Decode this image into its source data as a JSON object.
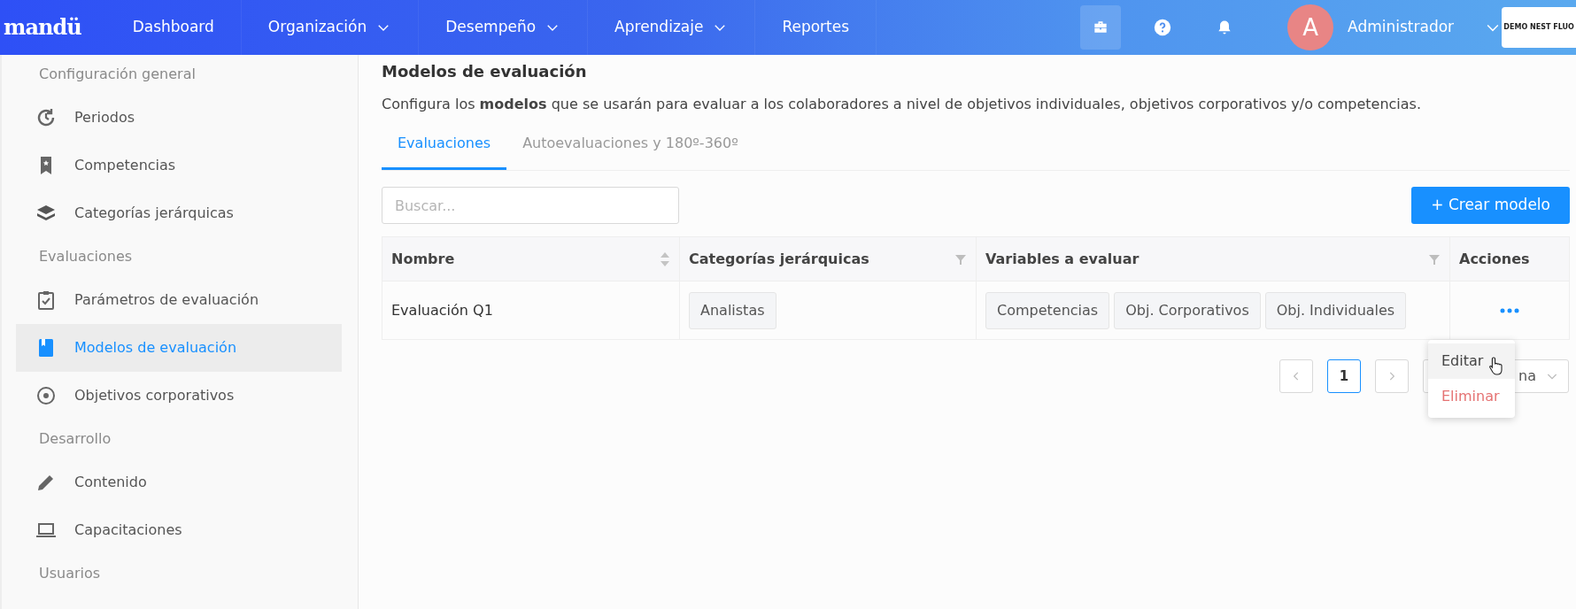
{
  "navbar": {
    "logo": "mandü",
    "items": [
      {
        "label": "Dashboard",
        "dropdown": false
      },
      {
        "label": "Organización",
        "dropdown": true
      },
      {
        "label": "Desempeño",
        "dropdown": true
      },
      {
        "label": "Aprendizaje",
        "dropdown": true
      },
      {
        "label": "Reportes",
        "dropdown": false
      }
    ],
    "user": {
      "avatar_letter": "A",
      "name": "Administrador"
    },
    "company": "DEMO NEST FLUO"
  },
  "sidebar": [
    {
      "heading": "Configuración general",
      "items": [
        {
          "label": "Periodos",
          "selected": false
        },
        {
          "label": "Competencias",
          "selected": false
        },
        {
          "label": "Categorías jerárquicas",
          "selected": false
        }
      ]
    },
    {
      "heading": "Evaluaciones",
      "items": [
        {
          "label": "Parámetros de evaluación",
          "selected": false
        },
        {
          "label": "Modelos de evaluación",
          "selected": true
        },
        {
          "label": "Objetivos corporativos",
          "selected": false
        }
      ]
    },
    {
      "heading": "Desarrollo",
      "items": [
        {
          "label": "Contenido",
          "selected": false
        },
        {
          "label": "Capacitaciones",
          "selected": false
        }
      ]
    },
    {
      "heading": "Usuarios"
    }
  ],
  "page": {
    "title": "Modelos de evaluación",
    "description": "Configura los **modelos** que se usarán para evaluar a los colaboradores a nivel de objetivos individuales, objetivos corporativos y/o competencias."
  },
  "tabs": [
    {
      "label": "Evaluaciones",
      "selected": true
    },
    {
      "label": "Autoevaluaciones y 180º-360º",
      "selected": false
    }
  ],
  "search": {
    "placeholder": "Buscar..."
  },
  "create_button": "+ Crear modelo",
  "table": {
    "columns": [
      {
        "label": "Nombre",
        "kind": "sortable"
      },
      {
        "label": "Categorías jerárquicas",
        "kind": "filterable"
      },
      {
        "label": "Variables a evaluar",
        "kind": "filterable"
      },
      {
        "label": "Acciones",
        "kind": "plain"
      }
    ],
    "rows": [
      {
        "name": "Evaluación Q1",
        "categories": [
          "Analistas"
        ],
        "variables": [
          "Competencias",
          "Obj. Corporativos",
          "Obj. Individuales"
        ]
      }
    ]
  },
  "pagination": {
    "pages": [
      {
        "label": "1",
        "selected": true
      }
    ],
    "page_size": "na"
  },
  "action_menu": [
    {
      "label": "Editar",
      "kind": "normal",
      "hovered": true
    },
    {
      "label": "Eliminar",
      "kind": "danger",
      "hovered": false
    }
  ]
}
